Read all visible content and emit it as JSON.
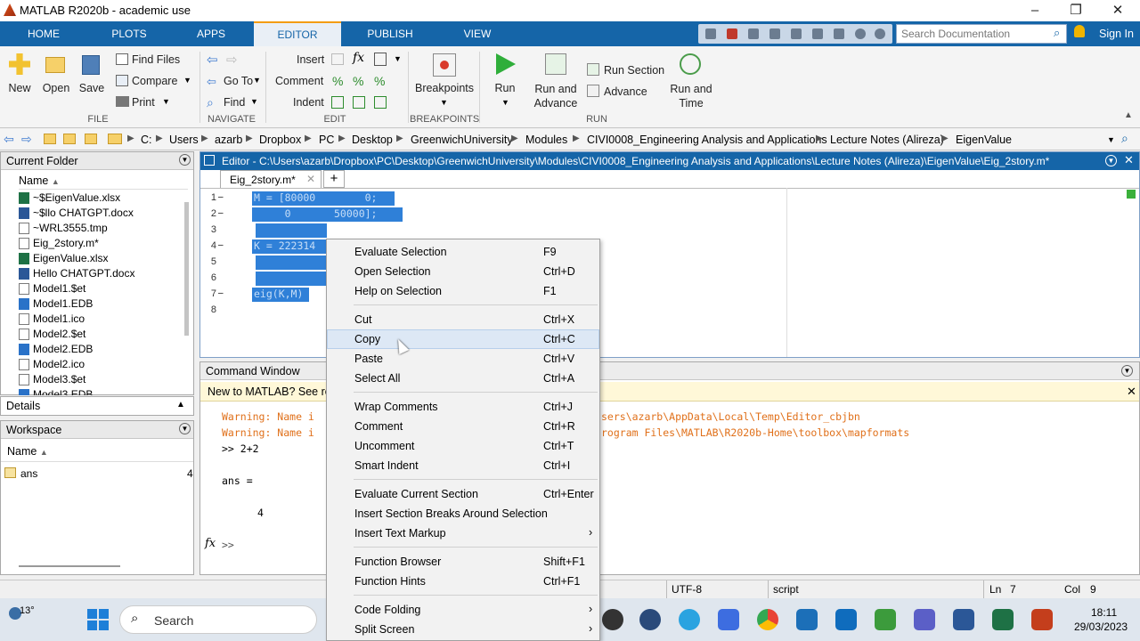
{
  "title": "MATLAB R2020b - academic use",
  "tabs": [
    "HOME",
    "PLOTS",
    "APPS",
    "EDITOR",
    "PUBLISH",
    "VIEW"
  ],
  "search_placeholder": "Search Documentation",
  "sign_in": "Sign In",
  "ribbon": {
    "new": "New",
    "open": "Open",
    "save": "Save",
    "find_files": "Find Files",
    "compare": "Compare",
    "print": "Print",
    "go_to": "Go To",
    "find": "Find",
    "insert": "Insert",
    "comment": "Comment",
    "indent": "Indent",
    "breakpoints": "Breakpoints",
    "run": "Run",
    "run_and_advance": "Run and Advance",
    "run_section": "Run Section",
    "advance": "Advance",
    "run_and_time": "Run and Time",
    "groups": {
      "file": "FILE",
      "navigate": "NAVIGATE",
      "edit": "EDIT",
      "breakpoints": "BREAKPOINTS",
      "run": "RUN"
    }
  },
  "path": [
    "C:",
    "Users",
    "azarb",
    "Dropbox",
    "PC",
    "Desktop",
    "GreenwichUniversity",
    "Modules",
    "CIVI0008_Engineering Analysis and Applications",
    "Lecture Notes (Alireza)",
    "EigenValue"
  ],
  "current_folder": {
    "title": "Current Folder",
    "col_name": "Name",
    "files": [
      {
        "name": "~$EigenValue.xlsx",
        "icon": "excel"
      },
      {
        "name": "~$llo CHATGPT.docx",
        "icon": "word"
      },
      {
        "name": "~WRL3555.tmp",
        "icon": "file"
      },
      {
        "name": "Eig_2story.m*",
        "icon": "file"
      },
      {
        "name": "EigenValue.xlsx",
        "icon": "excel"
      },
      {
        "name": "Hello CHATGPT.docx",
        "icon": "word"
      },
      {
        "name": "Model1.$et",
        "icon": "file"
      },
      {
        "name": "Model1.EDB",
        "icon": "edb"
      },
      {
        "name": "Model1.ico",
        "icon": "file"
      },
      {
        "name": "Model2.$et",
        "icon": "file"
      },
      {
        "name": "Model2.EDB",
        "icon": "edb"
      },
      {
        "name": "Model2.ico",
        "icon": "file"
      },
      {
        "name": "Model3.$et",
        "icon": "file"
      },
      {
        "name": "Model3.EDB",
        "icon": "edb"
      }
    ]
  },
  "details": "Details",
  "workspace": {
    "title": "Workspace",
    "col_name": "Name",
    "var": "ans",
    "value": "4"
  },
  "editor": {
    "header": "Editor - C:\\Users\\azarb\\Dropbox\\PC\\Desktop\\GreenwichUniversity\\Modules\\CIVI0008_Engineering Analysis and Applications\\Lecture Notes (Alireza)\\EigenValue\\Eig_2story.m*",
    "tab": "Eig_2story.m*",
    "lines": [
      "M = [80000        0;",
      "     0       50000];",
      "",
      "K = 222314",
      "",
      "",
      "eig(K,M)",
      ""
    ]
  },
  "command_window": {
    "title": "Command Window",
    "banner": "New to MATLAB? See res",
    "warn1_a": "Warning: Name i",
    "warn1_b": "sers\\azarb\\AppData\\Local\\Temp\\Editor_cbjbn",
    "warn2_a": "Warning: Name i",
    "warn2_b": "rogram Files\\MATLAB\\R2020b-Home\\toolbox\\mapformats",
    "cmd": ">> 2+2",
    "ans": "ans =",
    "val": "4",
    "prompt": ">>"
  },
  "context_menu": [
    {
      "label": "Evaluate Selection",
      "shortcut": "F9"
    },
    {
      "label": "Open Selection",
      "shortcut": "Ctrl+D"
    },
    {
      "label": "Help on Selection",
      "shortcut": "F1"
    },
    {
      "label": "Cut",
      "shortcut": "Ctrl+X"
    },
    {
      "label": "Copy",
      "shortcut": "Ctrl+C"
    },
    {
      "label": "Paste",
      "shortcut": "Ctrl+V"
    },
    {
      "label": "Select All",
      "shortcut": "Ctrl+A"
    },
    {
      "label": "Wrap Comments",
      "shortcut": "Ctrl+J"
    },
    {
      "label": "Comment",
      "shortcut": "Ctrl+R"
    },
    {
      "label": "Uncomment",
      "shortcut": "Ctrl+T"
    },
    {
      "label": "Smart Indent",
      "shortcut": "Ctrl+I"
    },
    {
      "label": "Evaluate Current Section",
      "shortcut": "Ctrl+Enter"
    },
    {
      "label": "Insert Section Breaks Around Selection",
      "shortcut": ""
    },
    {
      "label": "Insert Text Markup",
      "shortcut": ""
    },
    {
      "label": "Function Browser",
      "shortcut": "Shift+F1"
    },
    {
      "label": "Function Hints",
      "shortcut": "Ctrl+F1"
    },
    {
      "label": "Code Folding",
      "shortcut": ""
    },
    {
      "label": "Split Screen",
      "shortcut": ""
    }
  ],
  "status": {
    "encoding": "UTF-8",
    "type": "script",
    "ln": "Ln",
    "ln_val": "7",
    "col": "Col",
    "col_val": "9"
  },
  "taskbar": {
    "temp": "13°",
    "search": "Search",
    "time": "18:11",
    "date": "29/03/2023"
  }
}
